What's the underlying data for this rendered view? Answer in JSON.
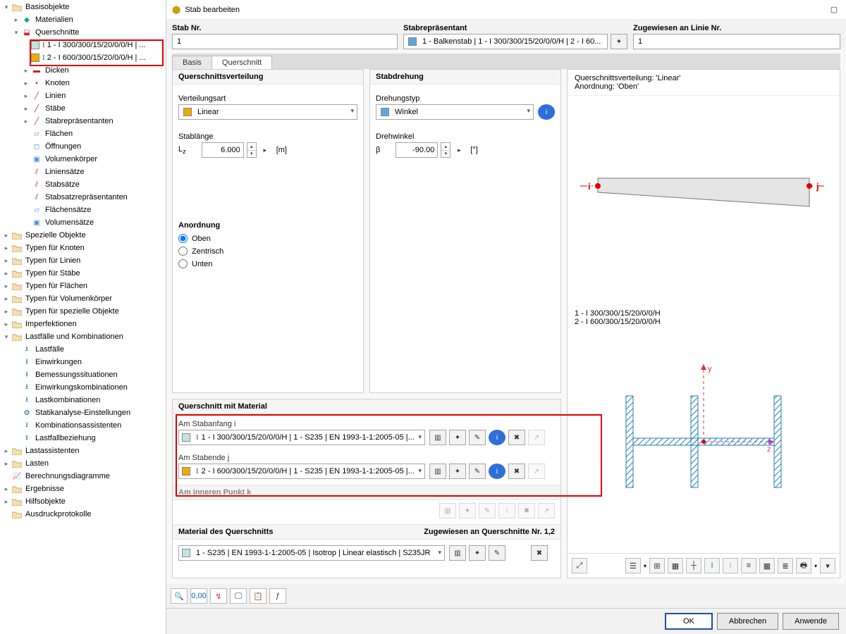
{
  "window": {
    "title": "Stab bearbeiten"
  },
  "tree": {
    "root": "Basisobjekte",
    "materialien": "Materialien",
    "querschnitte": "Querschnitte",
    "qs1": "1 - I 300/300/15/20/0/0/H | ...",
    "qs2": "2 - I 600/300/15/20/0/0/H | ...",
    "dicken": "Dicken",
    "knoten": "Knoten",
    "linien": "Linien",
    "staebe": "Stäbe",
    "stabrepr": "Stabrepräsentanten",
    "flaechen": "Flächen",
    "oeffnungen": "Öffnungen",
    "volumenkoerper": "Volumenkörper",
    "liniensaetze": "Liniensätze",
    "stabsaetze": "Stabsätze",
    "stabsatzrepr": "Stabsatzrepräsentanten",
    "flaechensaetze": "Flächensätze",
    "volumensaetze": "Volumensätze",
    "spezielle": "Spezielle Objekte",
    "typ_knoten": "Typen für Knoten",
    "typ_linien": "Typen für Linien",
    "typ_staebe": "Typen für Stäbe",
    "typ_flaechen": "Typen für Flächen",
    "typ_volumen": "Typen für Volumenkörper",
    "typ_spezielle": "Typen für spezielle Objekte",
    "imperfektionen": "Imperfektionen",
    "lastfaelle": "Lastfälle und Kombinationen",
    "lf_lastfaelle": "Lastfälle",
    "lf_einwirkungen": "Einwirkungen",
    "lf_bemessung": "Bemessungssituationen",
    "lf_einwirkk": "Einwirkungskombinationen",
    "lf_lastk": "Lastkombinationen",
    "lf_statik": "Statikanalyse-Einstellungen",
    "lf_kombi": "Kombinationsassistenten",
    "lf_bez": "Lastfallbeziehung",
    "lastassist": "Lastassistenten",
    "lasten": "Lasten",
    "berechnung": "Berechnungsdiagramme",
    "ergebnisse": "Ergebnisse",
    "hilfsobjekte": "Hilfsobjekte",
    "ausdruck": "Ausdruckprotokolle"
  },
  "header": {
    "stab_nr_label": "Stab Nr.",
    "stab_nr": "1",
    "repr_label": "Stabrepräsentant",
    "repr_value": "1 - Balkenstab | 1 - I 300/300/15/20/0/0/H | 2 - I 60...",
    "zug_label": "Zugewiesen an Linie Nr.",
    "zug_value": "1"
  },
  "tabs": {
    "basis": "Basis",
    "querschnitt": "Querschnitt"
  },
  "qs_panel": {
    "title": "Querschnittsverteilung",
    "verteilung_label": "Verteilungsart",
    "verteilung_value": "Linear",
    "stab_laenge_label": "Stablänge",
    "lz": "L",
    "zsub": "z",
    "lz_value": "6.000",
    "lz_unit": "[m]",
    "anordnung": "Anordnung",
    "oben": "Oben",
    "zentrisch": "Zentrisch",
    "unten": "Unten"
  },
  "rot_panel": {
    "title": "Stabdrehung",
    "drehtyp_label": "Drehungstyp",
    "drehtyp_value": "Winkel",
    "drehwinkel_label": "Drehwinkel",
    "beta": "β",
    "beta_value": "-90.00",
    "beta_unit": "[°]"
  },
  "viewer": {
    "l1": "Querschnittsverteilung: 'Linear'",
    "l2": "Anordnung: 'Oben'",
    "s1": "1 - I 300/300/15/20/0/0/H",
    "s2": "2 - I 600/300/15/20/0/0/H",
    "i": "i",
    "j": "j",
    "y": "y",
    "z": "z"
  },
  "qs_mat": {
    "title": "Querschnitt mit Material",
    "i_label": "Am Stabanfang i",
    "i_value": "1 - I 300/300/15/20/0/0/H | 1 - S235 | EN 1993-1-1:2005-05 |...",
    "j_label": "Am Stabende j",
    "j_value": "2 - I 600/300/15/20/0/0/H | 1 - S235 | EN 1993-1-1:2005-05 |...",
    "k_label": "Am inneren Punkt k",
    "mat_title": "Material des Querschnitts",
    "mat_assigned": "Zugewiesen an Querschnitte Nr. 1,2",
    "mat_value": "1 - S235 | EN 1993-1-1:2005-05 | Isotrop | Linear elastisch | S235JR"
  },
  "buttons": {
    "ok": "OK",
    "cancel": "Abbrechen",
    "apply": "Anwende"
  }
}
